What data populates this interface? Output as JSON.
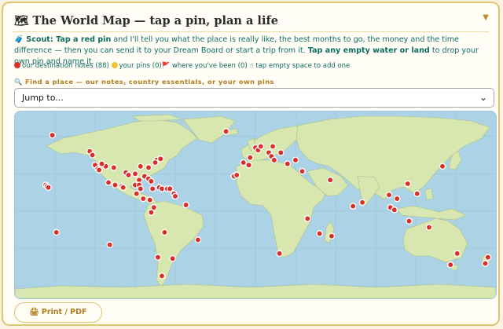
{
  "header": {
    "icon": "map-icon",
    "title": "🗺 The World Map — tap a pin, plan a life",
    "collapse_icon": "triangle-down-icon"
  },
  "intro": {
    "lead": "🧳 Scout: Tap a red pin",
    "part1": " and I'll tell you what the place is really like, the best months to go, the money and the time difference — then you can send it to your Dream Board or start a trip from it. ",
    "bold2": "Tap any empty water or land",
    "part2": " to drop your own pin and name it."
  },
  "legend": {
    "notes": "our destination notes (88)",
    "pins": "your pins (0)",
    "been": "🚩 where you've been (0)",
    "hint": "☝ tap empty space to add one"
  },
  "find": {
    "label": "🔍 Find a place — our notes, country essentials, or your own pins",
    "select_value": "Jump to..."
  },
  "map": {
    "ocean_color": "#acd2e6",
    "land_color": "#d8e7b0",
    "pin_color": "#d9302a",
    "pins": [
      [
        -152,
        61
      ],
      [
        -124,
        48
      ],
      [
        -122,
        45
      ],
      [
        -120,
        37
      ],
      [
        -118,
        34
      ],
      [
        -117,
        33
      ],
      [
        -112,
        36
      ],
      [
        -115,
        38
      ],
      [
        -106,
        35
      ],
      [
        -97,
        31
      ],
      [
        -90,
        30
      ],
      [
        -83,
        28
      ],
      [
        -80,
        26
      ],
      [
        -87,
        25
      ],
      [
        -74,
        41
      ],
      [
        -71,
        42
      ],
      [
        -80,
        35
      ],
      [
        -75,
        39
      ],
      [
        -86,
        36
      ],
      [
        -95,
        29
      ],
      [
        -100,
        20
      ],
      [
        -105,
        21
      ],
      [
        -99,
        19
      ],
      [
        -90,
        21
      ],
      [
        -87,
        21
      ],
      [
        -86,
        18
      ],
      [
        -84,
        10
      ],
      [
        -79,
        9
      ],
      [
        -77,
        18
      ],
      [
        -72,
        19
      ],
      [
        -70,
        18
      ],
      [
        -66,
        18
      ],
      [
        -64,
        18
      ],
      [
        -61,
        14
      ],
      [
        -60,
        12
      ],
      [
        -76,
        3
      ],
      [
        -78,
        -1
      ],
      [
        -68,
        -17
      ],
      [
        -157,
        21
      ],
      [
        -156,
        20
      ],
      [
        -155,
        19
      ],
      [
        -149,
        -17
      ],
      [
        -109,
        -27
      ],
      [
        -43,
        -23
      ],
      [
        -70,
        -52
      ],
      [
        -22,
        64
      ],
      [
        -9,
        39
      ],
      [
        -16,
        28
      ],
      [
        -14,
        29
      ],
      [
        -5,
        37
      ],
      [
        -4,
        43
      ],
      [
        0,
        51
      ],
      [
        2,
        49
      ],
      [
        4,
        52
      ],
      [
        13,
        52
      ],
      [
        10,
        47
      ],
      [
        12,
        44
      ],
      [
        14,
        41
      ],
      [
        19,
        47
      ],
      [
        24,
        38
      ],
      [
        30,
        41
      ],
      [
        35,
        32
      ],
      [
        56,
        25
      ],
      [
        73,
        4
      ],
      [
        80,
        7
      ],
      [
        100,
        13
      ],
      [
        101,
        3
      ],
      [
        104,
        1
      ],
      [
        106,
        10
      ],
      [
        114,
        22
      ],
      [
        121,
        14
      ],
      [
        115,
        -8
      ],
      [
        140,
        36
      ],
      [
        151,
        -34
      ],
      [
        146,
        -43
      ],
      [
        172,
        -42
      ],
      [
        174,
        -37
      ],
      [
        -73,
        -37
      ],
      [
        57,
        -20
      ],
      [
        48,
        -18
      ],
      [
        39,
        -6
      ],
      [
        18,
        -34
      ],
      [
        -52,
        5
      ],
      [
        130,
        -13
      ],
      [
        -110,
        23
      ],
      [
        -89,
        14
      ],
      [
        -78,
        24
      ],
      [
        -62,
        -38
      ]
    ]
  }
}
